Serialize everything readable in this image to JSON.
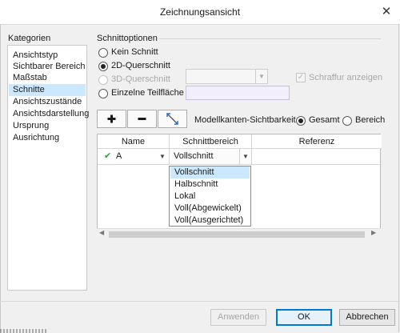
{
  "window": {
    "title": "Zeichnungsansicht",
    "close_glyph": "✕"
  },
  "categories": {
    "header": "Kategorien",
    "items": [
      "Ansichtstyp",
      "Sichtbarer Bereich",
      "Maßstab",
      "Schnitte",
      "Ansichtszustände",
      "Ansichtsdarstellung",
      "Ursprung",
      "Ausrichtung"
    ],
    "selected": "Schnitte"
  },
  "schnittoptionen": {
    "header": "Schnittoptionen",
    "kein_schnitt": "Kein Schnitt",
    "querschnitt_2d": "2D-Querschnitt",
    "querschnitt_3d": "3D-Querschnitt",
    "einzelne_teilflaeche": "Einzelne Teilfläche",
    "selected": "2D-Querschnitt",
    "schraffur_label": "Schraffur anzeigen",
    "schraffur_checked": true,
    "dropdown_3d_value": "",
    "teilflaeche_value": ""
  },
  "toolbar": {
    "add_icon": "plus-icon",
    "remove_icon": "minus-icon",
    "arrow_icon": "section-arrow-icon",
    "visibility_label": "Modellkanten-Sichtbarkeit",
    "gesamt": "Gesamt",
    "bereich": "Bereich",
    "selected": "Gesamt"
  },
  "table": {
    "columns": [
      "Name",
      "Schnittbereich",
      "Referenz"
    ],
    "rows": [
      {
        "check": "✔",
        "name": "A",
        "schnittbereich": "Vollschnitt",
        "referenz": ""
      }
    ]
  },
  "dropdown": {
    "options": [
      "Vollschnitt",
      "Halbschnitt",
      "Lokal",
      "Voll(Abgewickelt)",
      "Voll(Ausgerichtet)"
    ],
    "selected": "Vollschnitt"
  },
  "buttons": {
    "anwenden": "Anwenden",
    "ok": "OK",
    "abbrechen": "Abbrechen"
  },
  "colors": {
    "accent": "#0078d7",
    "selection": "#cce8ff",
    "check_green": "#2e9e3b"
  }
}
